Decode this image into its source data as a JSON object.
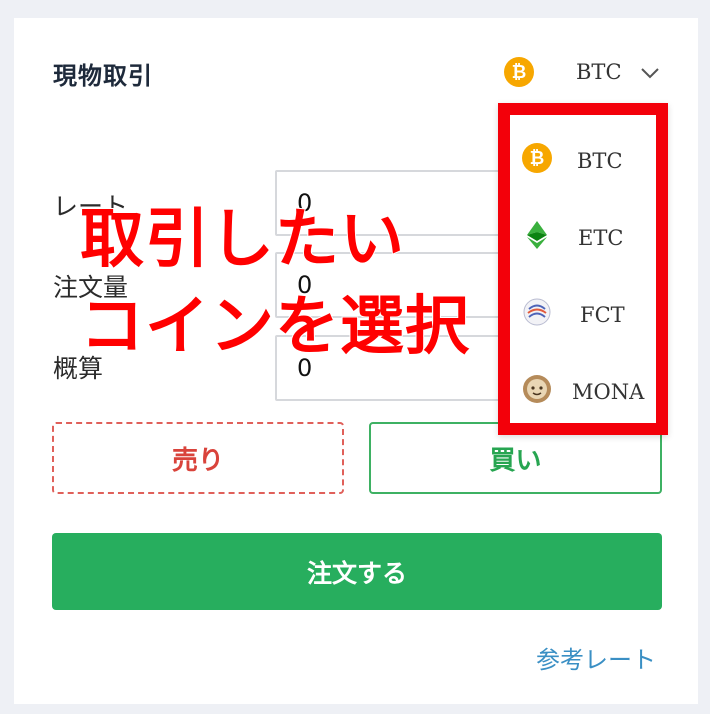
{
  "panel": {
    "title": "現物取引",
    "selected_coin": "BTC"
  },
  "form": {
    "rate_label": "レート",
    "rate_value": "0",
    "amount_label": "注文量",
    "amount_value": "0",
    "estimate_label": "概算",
    "estimate_value": "0"
  },
  "buttons": {
    "sell": "売り",
    "buy": "買い",
    "order": "注文する"
  },
  "links": {
    "reference_rate": "参考レート"
  },
  "dropdown": {
    "items": [
      {
        "label": "BTC",
        "icon": "bitcoin-icon"
      },
      {
        "label": "ETC",
        "icon": "ethereum-classic-icon"
      },
      {
        "label": "FCT",
        "icon": "factom-icon"
      },
      {
        "label": "MONA",
        "icon": "monacoin-icon"
      }
    ]
  },
  "annotation": {
    "line1": "取引したい",
    "line2": "コインを選択"
  },
  "colors": {
    "sell": "#d9433b",
    "buy": "#27a551",
    "order_bg": "#27ae5e",
    "highlight": "#f3000a",
    "btc": "#f7a700"
  }
}
